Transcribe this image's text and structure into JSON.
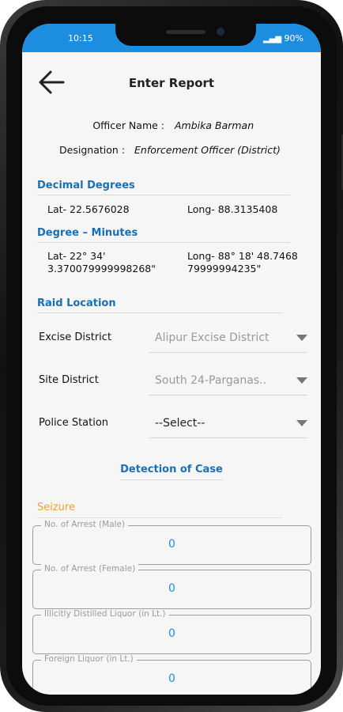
{
  "status_bar": {
    "time": "10:15",
    "battery": "90%"
  },
  "header": {
    "title": "Enter Report"
  },
  "officer": {
    "name_label": "Officer Name :",
    "name_value": "Ambika Barman",
    "designation_label": "Designation :",
    "designation_value": "Enforcement Officer (District)"
  },
  "decimal_degrees": {
    "heading": "Decimal Degrees",
    "lat": "Lat- 22.5676028",
    "long": "Long- 88.3135408"
  },
  "degree_minutes": {
    "heading": "Degree – Minutes",
    "lat_line1": "Lat- 22° 34'",
    "lat_line2": "3.370079999998268\"",
    "long_line1": "Long- 88° 18' 48.7468",
    "long_line2": "79999994235\""
  },
  "raid_location": {
    "heading": "Raid Location",
    "excise_district_label": "Excise District",
    "excise_district_value": "Alipur Excise District",
    "site_district_label": "Site District",
    "site_district_value": "South 24-Parganas..",
    "police_station_label": "Police Station",
    "police_station_value": "--Select--"
  },
  "detection": {
    "heading": "Detection of Case"
  },
  "seizure": {
    "heading": "Seizure",
    "fields": [
      {
        "label": "No. of Arrest (Male)",
        "value": "0"
      },
      {
        "label": "No. of Arrest (Female)",
        "value": "0"
      },
      {
        "label": "Illicitly Distilled Liquor (in Lt.)",
        "value": "0"
      },
      {
        "label": "Foreign Liquor (in Lt.)",
        "value": "0"
      }
    ]
  },
  "colors": {
    "status_bar": "#1d8de0",
    "section_heading": "#1a6fb3",
    "seizure_heading": "#f0a032",
    "field_value": "#1d8de0"
  }
}
